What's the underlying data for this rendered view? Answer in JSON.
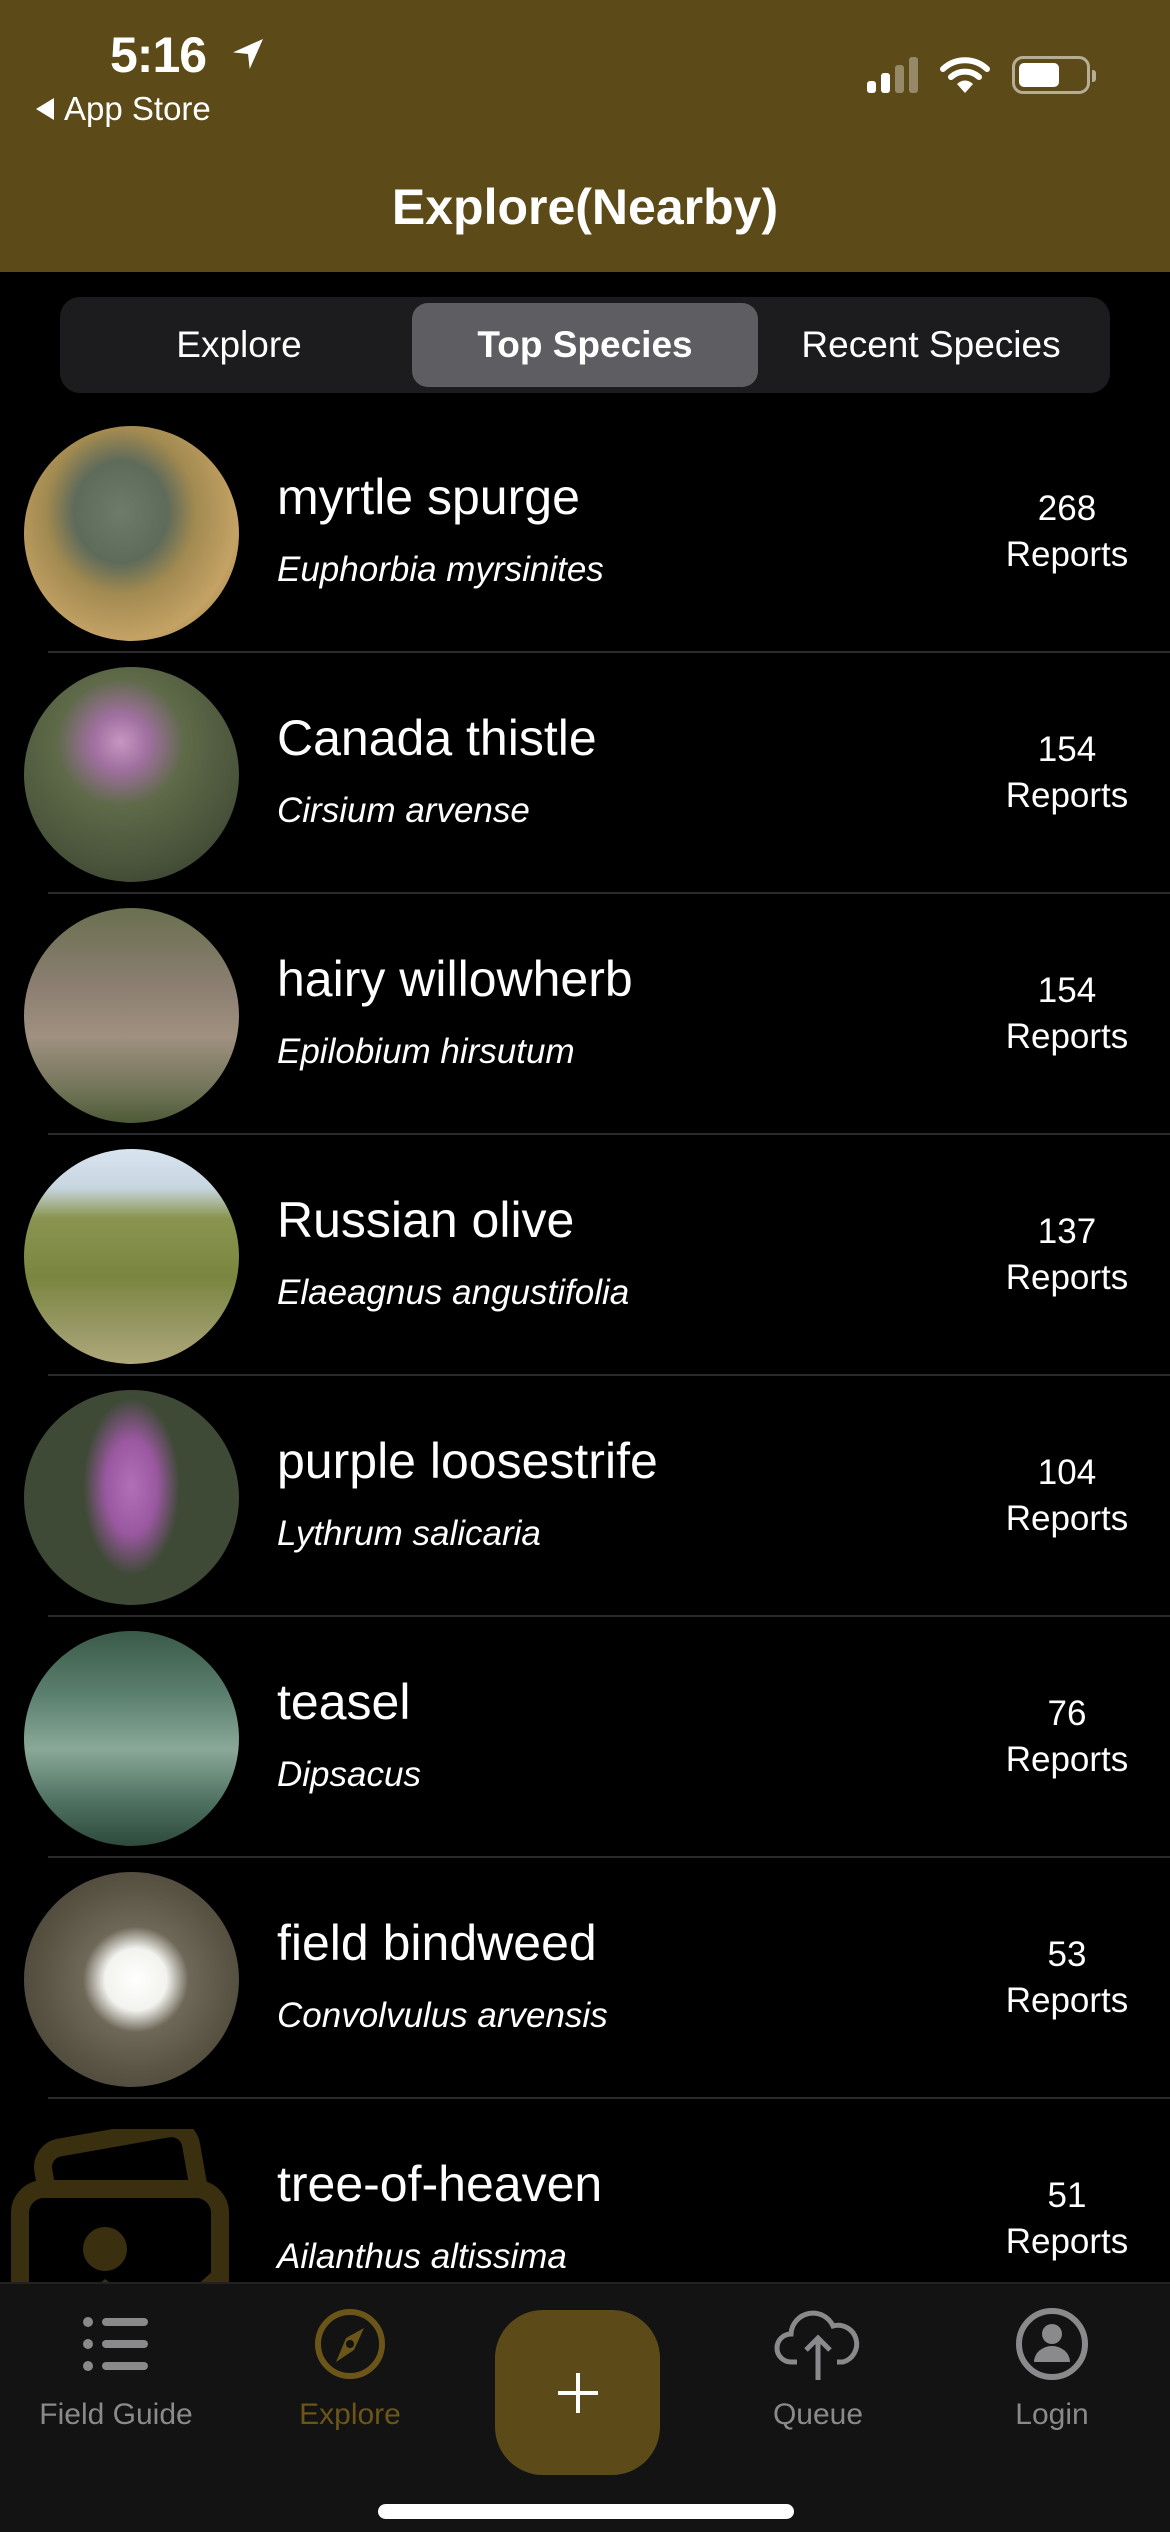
{
  "status_bar": {
    "time": "5:16",
    "back_label": "App Store"
  },
  "header": {
    "title": "Explore(Nearby)"
  },
  "segments": [
    {
      "label": "Explore",
      "active": false
    },
    {
      "label": "Top Species",
      "active": true
    },
    {
      "label": "Recent Species",
      "active": false
    }
  ],
  "species": [
    {
      "common": "myrtle spurge",
      "scientific": "Euphorbia myrsinites",
      "count": "268",
      "unit": "Reports"
    },
    {
      "common": "Canada thistle",
      "scientific": "Cirsium arvense",
      "count": "154",
      "unit": "Reports"
    },
    {
      "common": "hairy willowherb",
      "scientific": "Epilobium hirsutum",
      "count": "154",
      "unit": "Reports"
    },
    {
      "common": "Russian olive",
      "scientific": "Elaeagnus angustifolia",
      "count": "137",
      "unit": "Reports"
    },
    {
      "common": "purple loosestrife",
      "scientific": "Lythrum salicaria",
      "count": "104",
      "unit": "Reports"
    },
    {
      "common": "teasel",
      "scientific": "Dipsacus",
      "count": "76",
      "unit": "Reports"
    },
    {
      "common": "field bindweed",
      "scientific": "Convolvulus arvensis",
      "count": "53",
      "unit": "Reports"
    },
    {
      "common": "tree-of-heaven",
      "scientific": "Ailanthus altissima",
      "count": "51",
      "unit": "Reports"
    }
  ],
  "tabbar": {
    "items": [
      {
        "label": "Field Guide",
        "icon": "list-icon"
      },
      {
        "label": "Explore",
        "icon": "compass-icon",
        "active": true
      },
      {
        "label": "Queue",
        "icon": "cloud-upload-icon"
      },
      {
        "label": "Login",
        "icon": "person-circle-icon"
      }
    ],
    "add_icon": "plus-icon"
  },
  "colors": {
    "brand": "#5C4B18",
    "active_tab": "#6B5518",
    "inactive_tab": "#8A8A8C"
  }
}
